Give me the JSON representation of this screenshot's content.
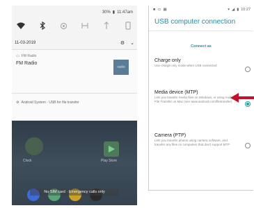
{
  "left_phone": {
    "status": {
      "battery": "30%",
      "time": "11:47am"
    },
    "quick_settings": {
      "icons": [
        "wifi-icon",
        "bluetooth-icon",
        "cast-icon",
        "hotspot-icon",
        "rotation-icon",
        "flashlight-icon"
      ]
    },
    "date": "11-03-2019",
    "notification_fm": {
      "app": "FM Radio",
      "title": "FM Radio",
      "thumb_text": "radio"
    },
    "notification_system": {
      "text": "Android System · USB for file transfer"
    },
    "apps": [
      {
        "label": "Clock"
      },
      {
        "label": "Play Store"
      }
    ],
    "toast": "No SIM card · Emergency calls only"
  },
  "right_phone": {
    "status": {
      "time": "10:27"
    },
    "title": "USB computer connection",
    "connect_as": "Connect as",
    "options": [
      {
        "title": "Charge only",
        "desc": "Use charge only mode when USB connected",
        "selected": false
      },
      {
        "title": "Media device (MTP)",
        "desc": "Lets you transfer media files on Windows, or using Android File Transfer on Mac (see www.android.com/filetransfer)",
        "selected": true
      },
      {
        "title": "Camera (PTP)",
        "desc": "Lets you transfer photos using camera software, and transfer any files on computers that don't support MTP",
        "selected": false
      }
    ]
  },
  "colors": {
    "accent": "#1f8fa8",
    "radio_selected": "#19a3a3",
    "annotation_arrow": "#c8102e"
  }
}
